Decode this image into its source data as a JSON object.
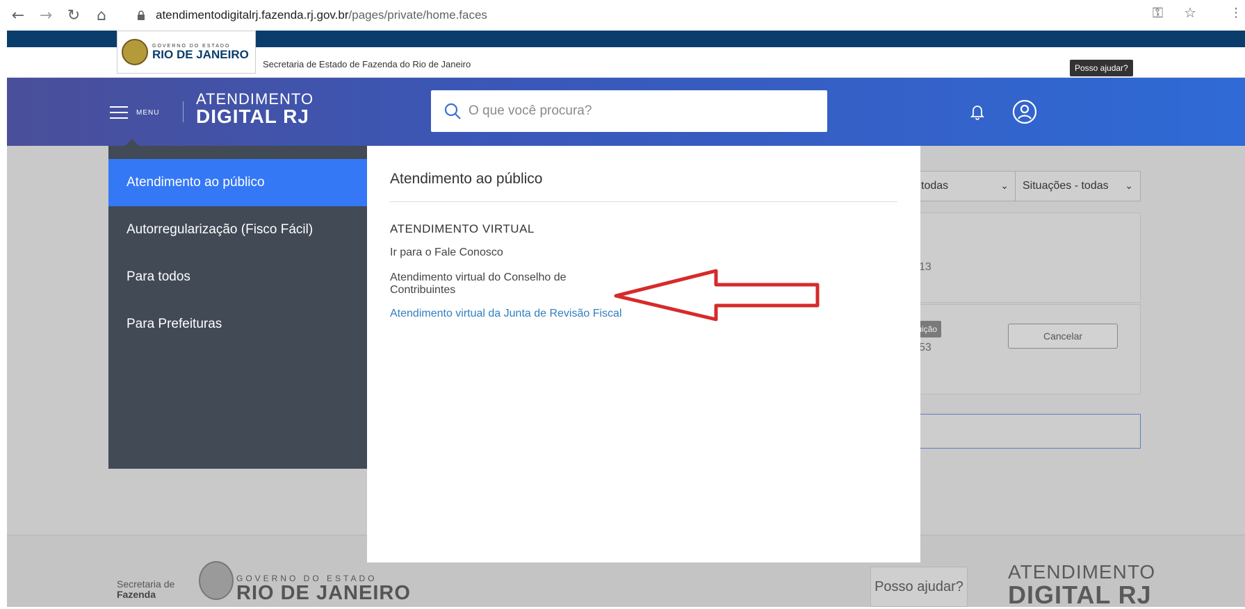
{
  "browser": {
    "url_host": "atendimentodigitalrj.fazenda.rj.gov.br",
    "url_path": "/pages/private/home.faces"
  },
  "gov_header": {
    "gov_small": "GOVERNO DO ESTADO",
    "gov_big": "RIO DE JANEIRO",
    "secretaria": "Secretaria de Estado de Fazenda do Rio de Janeiro",
    "help_label": "Posso ajudar?"
  },
  "app_header": {
    "menu_label": "MENU",
    "brand_line1": "ATENDIMENTO",
    "brand_line2": "DIGITAL RJ",
    "search_placeholder": "O que você procura?"
  },
  "menu": {
    "items": [
      {
        "label": "Atendimento ao público",
        "active": true
      },
      {
        "label": "Autorregularização (Fisco Fácil)",
        "active": false
      },
      {
        "label": "Para todos",
        "active": false
      },
      {
        "label": "Para Prefeituras",
        "active": false
      }
    ],
    "panel": {
      "title": "Atendimento ao público",
      "section_heading": "ATENDIMENTO VIRTUAL",
      "links": [
        {
          "label": "Ir para o Fale Conosco"
        },
        {
          "label": "Atendimento virtual do Conselho de Contribuintes"
        },
        {
          "label": "Atendimento virtual da Junta de Revisão Fiscal"
        }
      ]
    }
  },
  "background_page": {
    "filter1_text": "todas",
    "filter2_text": "Situações - todas",
    "card1_number": "13",
    "card2_badge": "ribuição",
    "card2_number": "53",
    "cancel_label": "Cancelar"
  },
  "footer": {
    "secretaria_line1": "Secretaria de",
    "secretaria_line2": "Fazenda",
    "gov_small": "GOVERNO DO ESTADO",
    "gov_big": "RIO DE JANEIRO",
    "help_label": "Posso ajudar?",
    "brand_line1": "ATENDIMENTO",
    "brand_line2": "DIGITAL RJ"
  },
  "colors": {
    "active_menu": "#3478f6",
    "sidebar": "#414a55",
    "gov_stripe": "#0a3d6b",
    "annotation_arrow": "#d62b2b"
  }
}
